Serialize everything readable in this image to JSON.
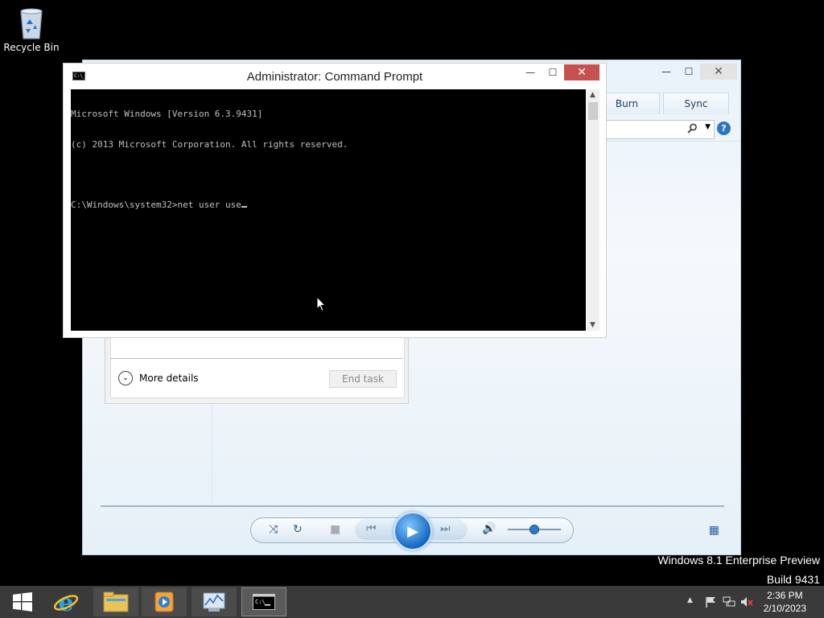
{
  "desktop": {
    "recycle_bin_label": "Recycle Bin",
    "watermark_line1": "Windows 8.1 Enterprise Preview",
    "watermark_line2": "Build 9431"
  },
  "media_player": {
    "tabs": [
      "Burn",
      "Sync"
    ],
    "search_icon": "search-icon",
    "help_icon": "help-icon"
  },
  "task_manager": {
    "more_details": "More details",
    "end_task": "End task"
  },
  "cmd": {
    "title": "Administrator: Command Prompt",
    "icon_text": "C:\\_",
    "minimize": "—",
    "maximize": "☐",
    "close": "✕",
    "lines": [
      "Microsoft Windows [Version 6.3.9431]",
      "(c) 2013 Microsoft Corporation. All rights reserved.",
      "",
      "C:\\Windows\\system32>net user use"
    ]
  },
  "taskbar": {
    "items": [
      "start-button",
      "internet-explorer",
      "file-explorer",
      "windows-media-player",
      "task-manager",
      "command-prompt"
    ],
    "clock_time": "2:36 PM",
    "clock_date": "2/10/2023"
  },
  "colors": {
    "taskbar": "#3a3a3a",
    "cmd_close": "#c75050",
    "console_text": "#c0c0c0"
  }
}
